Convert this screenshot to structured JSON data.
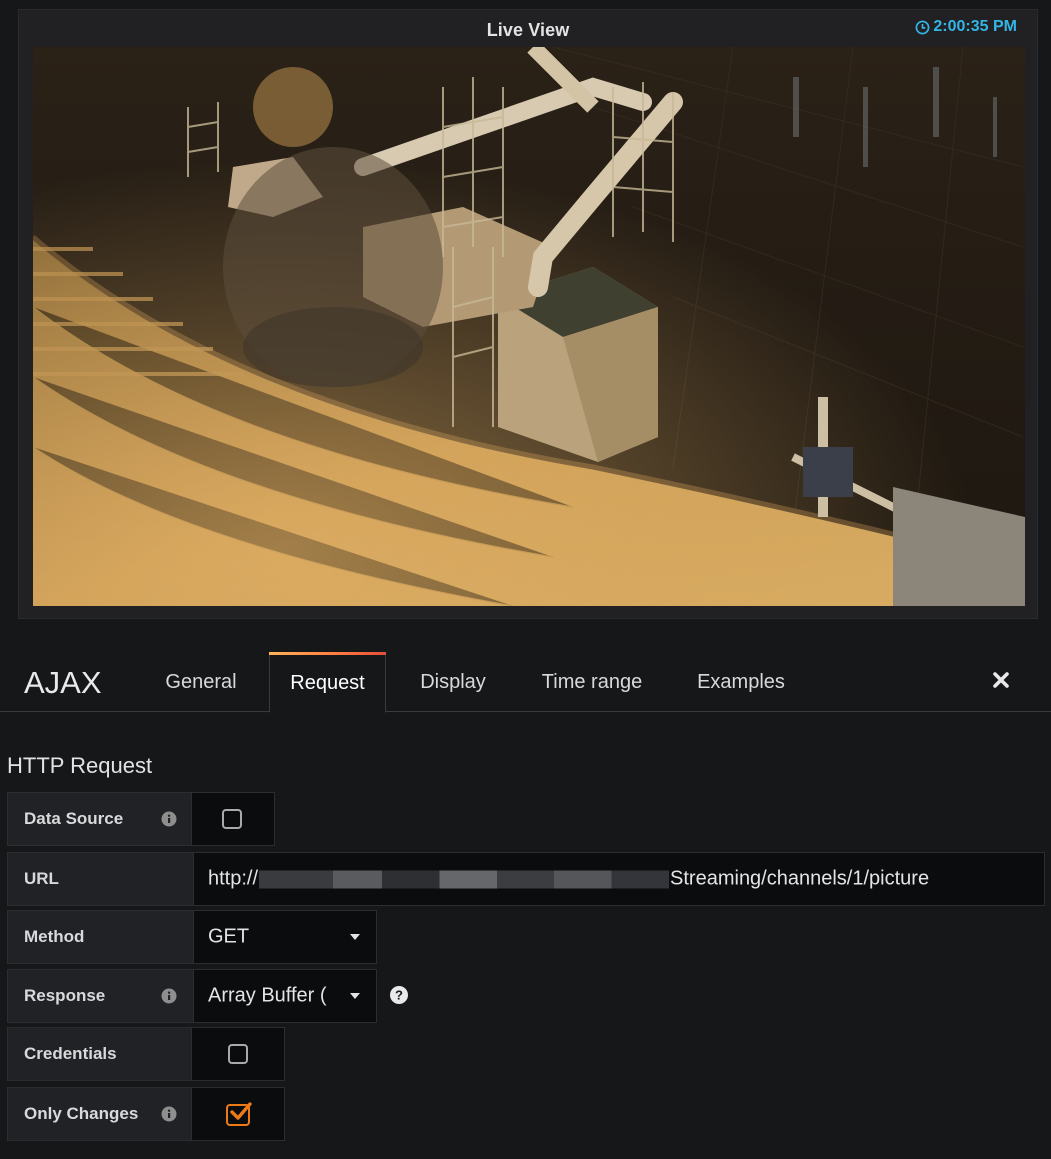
{
  "panel": {
    "title": "Live View",
    "time": "2:00:35 PM"
  },
  "editor": {
    "title": "AJAX",
    "tabs": [
      {
        "label": "General",
        "active": false
      },
      {
        "label": "Request",
        "active": true
      },
      {
        "label": "Display",
        "active": false
      },
      {
        "label": "Time range",
        "active": false
      },
      {
        "label": "Examples",
        "active": false
      }
    ],
    "close_icon": "close-icon"
  },
  "form": {
    "section_title": "HTTP Request",
    "data_source": {
      "label": "Data Source",
      "checked": false
    },
    "url": {
      "label": "URL",
      "prefix": "http://",
      "suffix": "Streaming/channels/1/picture"
    },
    "method": {
      "label": "Method",
      "value": "GET"
    },
    "response": {
      "label": "Response",
      "value": "Array Buffer ("
    },
    "credentials": {
      "label": "Credentials",
      "checked": false
    },
    "only_changes": {
      "label": "Only Changes",
      "checked": true
    }
  },
  "colors": {
    "accent": "#eb7b18",
    "time": "#33b5e5",
    "background": "#161719"
  }
}
